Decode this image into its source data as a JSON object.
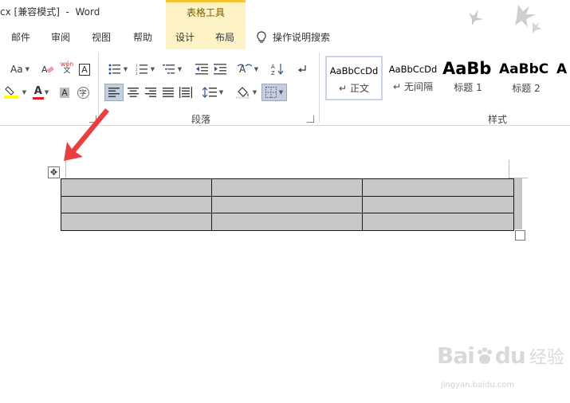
{
  "window": {
    "title_fragment": "cx [兼容模式]  -  Word",
    "contextual_title": "表格工具"
  },
  "tabs": [
    {
      "label": "邮件"
    },
    {
      "label": "审阅"
    },
    {
      "label": "视图"
    },
    {
      "label": "帮助"
    },
    {
      "label": "设计"
    },
    {
      "label": "布局"
    }
  ],
  "tell_me": {
    "label": "操作说明搜索",
    "icon": "lightbulb-icon"
  },
  "ribbon": {
    "font_group": {
      "aa_label": "Aa",
      "wen_label": "wén",
      "a_box_label": "A",
      "a_shade_label": "A",
      "enclose_label": "字",
      "font_color_label": "A",
      "highlight_color": "#ffff00",
      "font_color": "#e01e1e"
    },
    "paragraph_group": {
      "label": "段落"
    },
    "styles_group": {
      "label": "样式"
    },
    "styles": [
      {
        "sample": "AaBbCcDd",
        "name": "正文",
        "prefix": "↵",
        "selected": true
      },
      {
        "sample": "AaBbCcDd",
        "name": "无间隔",
        "prefix": "↵",
        "selected": false
      },
      {
        "sample": "AaBb",
        "name": "标题 1",
        "prefix": "",
        "selected": false
      },
      {
        "sample": "AaBbC",
        "name": "标题 2",
        "prefix": "",
        "selected": false
      },
      {
        "sample": "A",
        "name": "",
        "prefix": "",
        "selected": false
      }
    ]
  },
  "document": {
    "table": {
      "rows": 3,
      "cols": 3,
      "cells": [
        [
          "",
          "",
          ""
        ],
        [
          "",
          "",
          ""
        ],
        [
          "",
          "",
          ""
        ]
      ]
    },
    "move_handle_glyph": "✥",
    "arrow_color": "#e84040"
  },
  "watermark": {
    "logo": "Bai",
    "logo2": "du",
    "cn": "经验",
    "url": "jingyan.baidu.com"
  }
}
